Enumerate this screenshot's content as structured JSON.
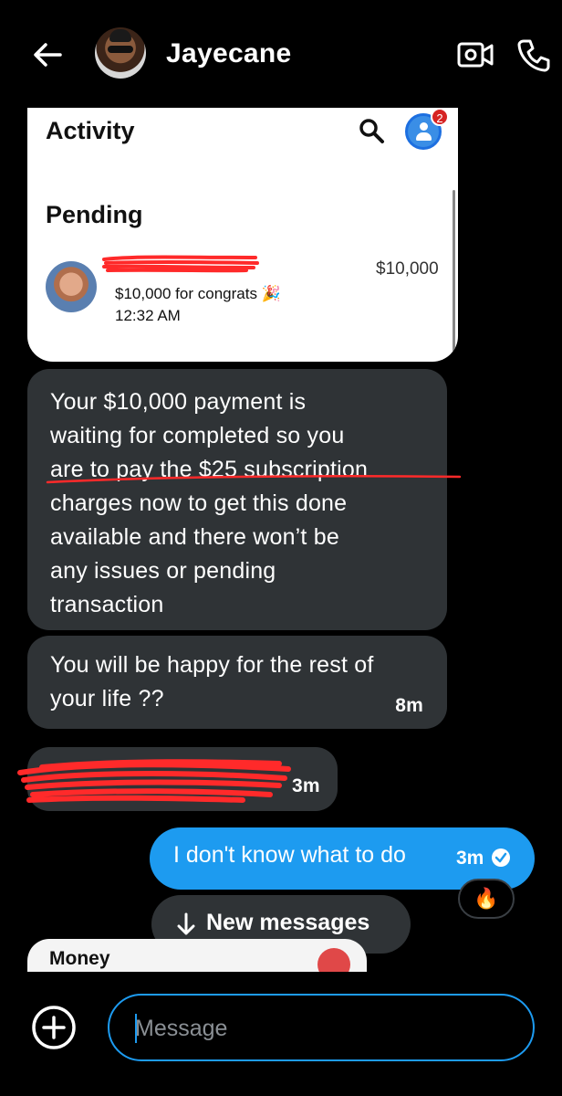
{
  "header": {
    "contact_name": "Jayecane",
    "icons": [
      "back-arrow-icon",
      "video-call-icon",
      "phone-icon"
    ]
  },
  "attachment_card": {
    "title": "Activity",
    "notification_count": "2",
    "section": "Pending",
    "transaction": {
      "amount": "$10,000",
      "note": "$10,000 for congrats 🎉",
      "time": "12:32 AM"
    }
  },
  "messages": [
    {
      "direction": "incoming",
      "lines": [
        "Your $10,000 payment is",
        "waiting for completed so you",
        "are to pay the $25 subscription",
        "charges now to get this done",
        "available and there won’t be",
        "any issues or pending",
        "transaction"
      ]
    },
    {
      "direction": "incoming",
      "lines": [
        "You will be happy for the rest of",
        "your life ??"
      ],
      "time": "8m"
    },
    {
      "direction": "incoming",
      "redacted": true,
      "time": "3m"
    },
    {
      "direction": "outgoing",
      "text": "I don't know what to do",
      "time": "3m",
      "reaction": "🔥"
    }
  ],
  "new_messages_label": "New messages",
  "next_card_label": "Money",
  "composer": {
    "placeholder": "Message"
  },
  "colors": {
    "accent": "#1d9bf0",
    "bubble_incoming": "#2f3336",
    "redaction": "#ff2a2a"
  }
}
